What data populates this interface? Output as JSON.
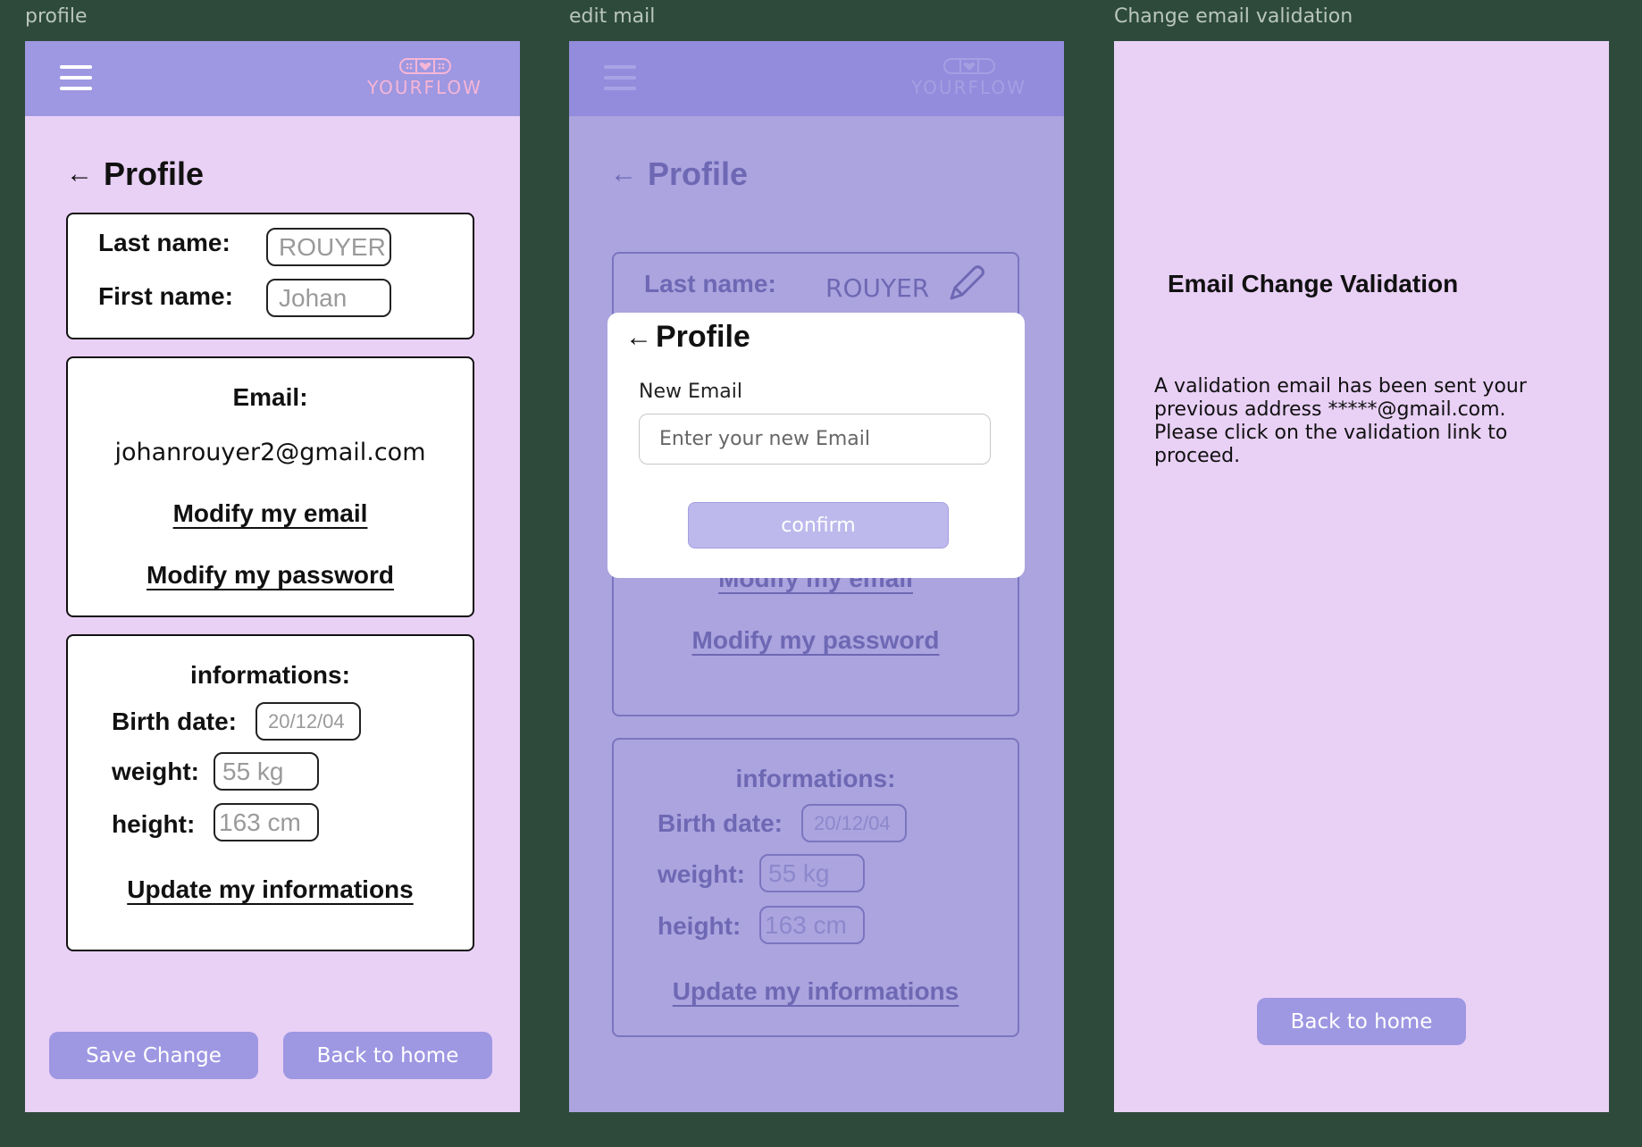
{
  "frames": {
    "profile": {
      "label": "profile",
      "logo_text": "YOURFLOW",
      "title": "Profile",
      "last_name_label": "Last name:",
      "last_name_value": "ROUYER",
      "first_name_label": "First name:",
      "first_name_value": "Johan",
      "email_label": "Email:",
      "email_value": "johanrouyer2@gmail.com",
      "modify_email": "Modify my email",
      "modify_password": "Modify my password",
      "info_label": "informations:",
      "birth_label": "Birth date:",
      "birth_value": "20/12/04",
      "weight_label": "weight:",
      "weight_value": "55 kg",
      "height_label": "height:",
      "height_value": "163 cm",
      "update_info": "Update my informations",
      "save_button": "Save Change",
      "home_button": "Back to home"
    },
    "edit_mail": {
      "label": "edit mail",
      "logo_text": "YOURFLOW",
      "title": "Profile",
      "last_name_label": "Last name:",
      "last_name_value": "ROUYER",
      "modify_email": "Modify my email",
      "modify_password": "Modify my password",
      "info_label": "informations:",
      "birth_label": "Birth date:",
      "birth_value": "20/12/04",
      "weight_label": "weight:",
      "weight_value": "55 kg",
      "height_label": "height:",
      "height_value": "163 cm",
      "update_info": "Update my informations",
      "modal": {
        "title": "Profile",
        "field_label": "New Email",
        "placeholder": "Enter your new Email",
        "confirm": "confirm"
      }
    },
    "validation": {
      "label": "Change email validation",
      "heading": "Email Change Validation",
      "message": "A validation email has been sent your previous address *****@gmail.com. Please click on the validation link to proceed.",
      "home_button": "Back to home"
    }
  },
  "colors": {
    "background": "#2e4a3b",
    "frame": "#e9d0f5",
    "accent": "#9e97e2",
    "overlay": "#aba4df",
    "logo": "#f6b6d6"
  },
  "icons": [
    "menu-icon",
    "logo-icon",
    "back-arrow-icon",
    "pencil-icon"
  ]
}
